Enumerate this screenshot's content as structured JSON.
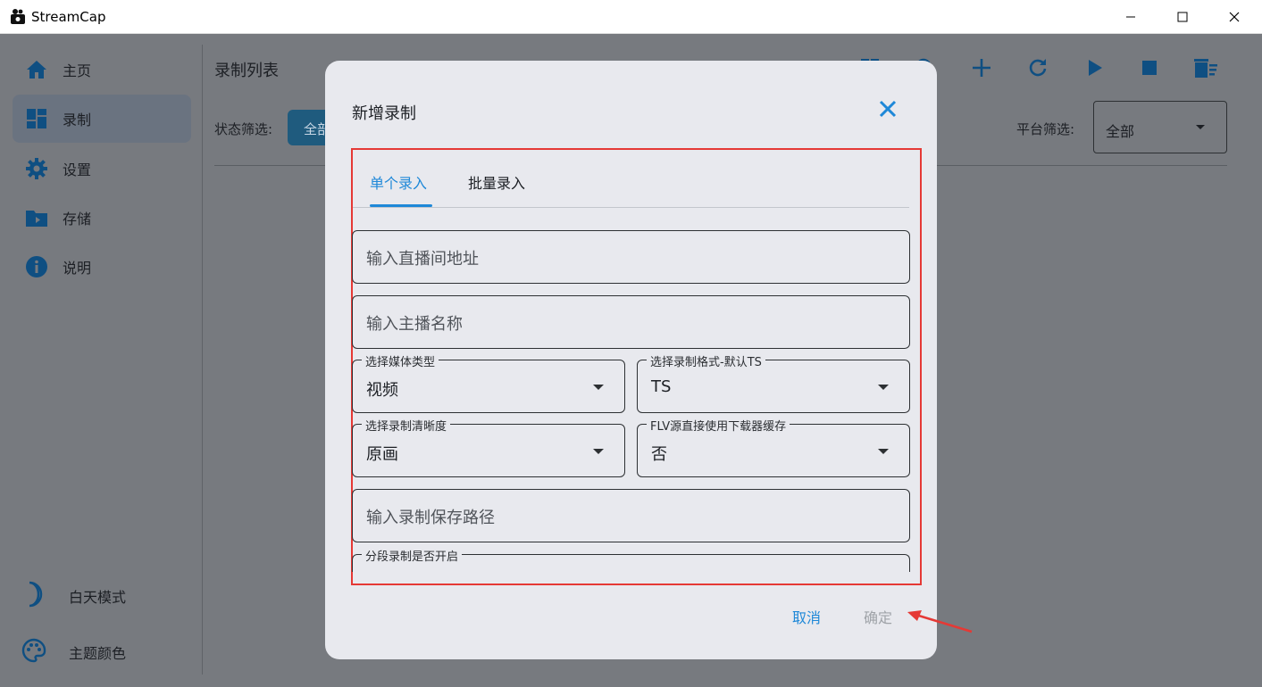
{
  "window": {
    "title": "StreamCap",
    "controls": {
      "minimize": "minimize-icon",
      "maximize": "maximize-icon",
      "close": "close-icon"
    }
  },
  "sidebar": {
    "items": [
      {
        "label": "主页",
        "icon": "home-icon",
        "active": false
      },
      {
        "label": "录制",
        "icon": "dashboard-icon",
        "active": true
      },
      {
        "label": "设置",
        "icon": "gear-icon",
        "active": false
      },
      {
        "label": "存储",
        "icon": "folder-icon",
        "active": false
      },
      {
        "label": "说明",
        "icon": "info-icon",
        "active": false
      }
    ],
    "bottom": [
      {
        "label": "白天模式",
        "icon": "moon-icon"
      },
      {
        "label": "主题颜色",
        "icon": "palette-icon"
      }
    ]
  },
  "page": {
    "title": "录制列表",
    "toolbar": [
      "grid-view-icon",
      "search-icon",
      "add-icon",
      "refresh-icon",
      "play-icon",
      "stop-icon",
      "delete-sweep-icon"
    ],
    "status_filter_label": "状态筛选:",
    "status_filter_value": "全部",
    "platform_filter_label": "平台筛选:",
    "platform_filter_value": "全部"
  },
  "dialog": {
    "title": "新增录制",
    "tabs": [
      {
        "label": "单个录入",
        "selected": true
      },
      {
        "label": "批量录入",
        "selected": false
      }
    ],
    "fields": {
      "url_placeholder": "输入直播间地址",
      "streamer_placeholder": "输入主播名称",
      "media_type": {
        "label": "选择媒体类型",
        "value": "视频"
      },
      "record_format": {
        "label": "选择录制格式-默认TS",
        "value": "TS"
      },
      "quality": {
        "label": "选择录制清晰度",
        "value": "原画"
      },
      "flv_cache": {
        "label": "FLV源直接使用下载器缓存",
        "value": "否"
      },
      "save_path_placeholder": "输入录制保存路径",
      "segment": {
        "label": "分段录制是否开启"
      }
    },
    "cancel_label": "取消",
    "ok_label": "确定"
  },
  "colors": {
    "accent": "#1e88d8",
    "annotation": "#e53935",
    "dialog_bg": "#e8e9ee",
    "scrim": "#777a7f"
  }
}
